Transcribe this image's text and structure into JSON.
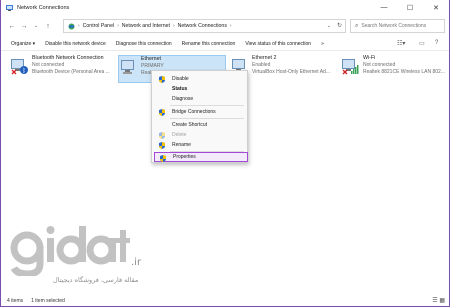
{
  "window": {
    "title": "Network Connections",
    "controls": {
      "minimize": "—",
      "maximize": "☐",
      "close": "✕"
    }
  },
  "address": {
    "crumbs": [
      "Control Panel",
      "Network and Internet",
      "Network Connections"
    ],
    "search_placeholder": "Search Network Connections"
  },
  "toolbar": {
    "organize": "Organize ▾",
    "disable": "Disable this network device",
    "diagnose": "Diagnose this connection",
    "rename": "Rename this connection",
    "view_status": "View status of this connection",
    "more": "»"
  },
  "connections": [
    {
      "name": "Bluetooth Network Connection",
      "status": "Not connected",
      "device": "Bluetooth Device (Personal Area ..."
    },
    {
      "name": "Ethernet",
      "status": "PRIMARY",
      "device": "Real..."
    },
    {
      "name": "Ethernet 2",
      "status": "Enabled",
      "device": "VirtualBox Host-Only Ethernet Ad..."
    },
    {
      "name": "Wi-Fi",
      "status": "Not connected",
      "device": "Realtek 8821CE Wireless LAN 802..."
    }
  ],
  "context_menu": {
    "items": [
      {
        "label": "Disable",
        "shield": true
      },
      {
        "label": "Status",
        "bold": true
      },
      {
        "label": "Diagnose"
      },
      {
        "label": "Bridge Connections",
        "shield": true
      },
      {
        "label": "Create Shortcut"
      },
      {
        "label": "Delete",
        "shield": true,
        "disabled": true
      },
      {
        "label": "Rename",
        "shield": true
      },
      {
        "label": "Properties",
        "shield": true,
        "highlighted": true
      }
    ]
  },
  "status": {
    "count": "4 items",
    "selected": "1 item selected"
  },
  "watermark": {
    "logo": "gidat",
    "domain": ".ir",
    "subtitle": "مقاله فارسی، فروشگاه دیجیتال"
  },
  "colors": {
    "accent": "#a24ad6",
    "selection": "#cce4f7",
    "shield_blue": "#2b68c9",
    "shield_yellow": "#f2c200"
  }
}
